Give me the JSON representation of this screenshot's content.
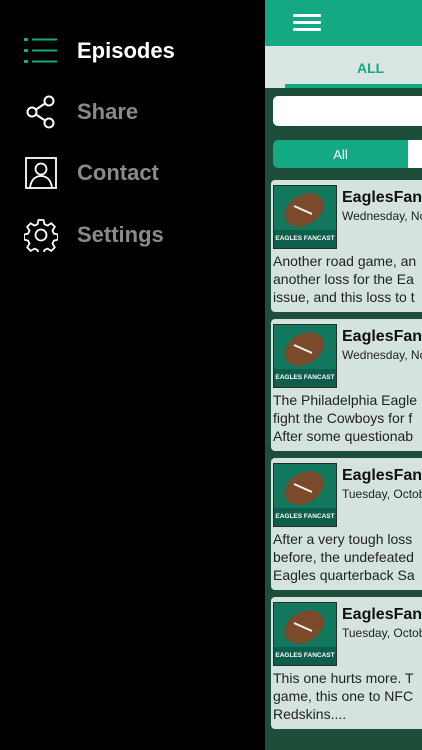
{
  "drawer": {
    "items": [
      {
        "label": "Episodes",
        "icon": "list-icon",
        "active": true
      },
      {
        "label": "Share",
        "icon": "share-icon",
        "active": false
      },
      {
        "label": "Contact",
        "icon": "contact-icon",
        "active": false
      },
      {
        "label": "Settings",
        "icon": "gear-icon",
        "active": false
      }
    ]
  },
  "main": {
    "tab_all": "ALL",
    "segment_all": "All",
    "episodes": [
      {
        "title": "EaglesFanC",
        "date": "Wednesday, No",
        "desc": "Another road game, an\nanother loss for the Ea\nissue, and this loss to t",
        "thumb_label": "EAGLES FANCAST"
      },
      {
        "title": "EaglesFanC",
        "date": "Wednesday, No",
        "desc": "The Philadelphia Eagle\nfight the Cowboys for f\nAfter some questionab",
        "thumb_label": "EAGLES FANCAST"
      },
      {
        "title": "EaglesFanC",
        "date": "Tuesday, Octob",
        "desc": "After a very tough loss\nbefore, the undefeated\nEagles quarterback Sa",
        "thumb_label": "EAGLES FANCAST"
      },
      {
        "title": "EaglesFanC",
        "date": "Tuesday, Octob",
        "desc": "This one hurts more. T\ngame, this one to NFC\nRedskins....",
        "thumb_label": "EAGLES FANCAST"
      }
    ]
  },
  "colors": {
    "accent": "#14a883",
    "drawer_bg": "#000000",
    "card_bg": "#d4e3de"
  }
}
